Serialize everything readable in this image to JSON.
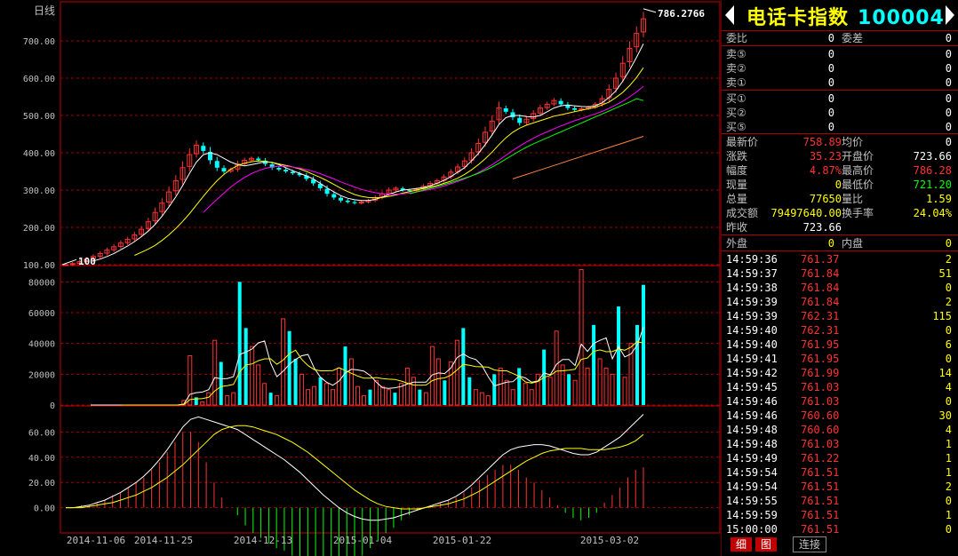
{
  "chart_data": {
    "type": "candlestick",
    "title": "日线",
    "last_label": "786.2766",
    "start_label": "100",
    "price_axis": {
      "ticks": [
        "700.00",
        "600.00",
        "500.00",
        "400.00",
        "300.00",
        "200.00",
        "100.00"
      ],
      "ylim": [
        100,
        800
      ]
    },
    "volume_axis": {
      "ticks": [
        "80000",
        "60000",
        "40000",
        "20000",
        "0"
      ],
      "ylim": [
        0,
        90000
      ]
    },
    "macd_axis": {
      "ticks": [
        "60.00",
        "40.00",
        "20.00",
        "0.00"
      ],
      "ylim": [
        -20,
        80
      ]
    },
    "date_labels": [
      "2014-11-06",
      "2014-11-25",
      "2014-12-13",
      "2015-01-04",
      "2015-01-22",
      "2015-03-02"
    ],
    "closes": [
      100,
      103,
      108,
      115,
      122,
      130,
      139,
      148,
      158,
      168,
      180,
      195,
      215,
      240,
      265,
      295,
      325,
      360,
      395,
      420,
      405,
      380,
      360,
      350,
      355,
      370,
      380,
      385,
      380,
      370,
      360,
      355,
      350,
      345,
      340,
      330,
      318,
      305,
      290,
      280,
      272,
      268,
      265,
      268,
      272,
      280,
      290,
      300,
      305,
      300,
      298,
      302,
      310,
      318,
      325,
      335,
      348,
      362,
      378,
      400,
      425,
      455,
      485,
      520,
      510,
      495,
      480,
      490,
      505,
      520,
      530,
      540,
      530,
      520,
      515,
      518,
      522,
      530,
      545,
      570,
      600,
      640,
      680,
      720,
      759
    ],
    "volumes": [
      0,
      0,
      0,
      0,
      0,
      0,
      0,
      0,
      0,
      0,
      0,
      0,
      0,
      0,
      0,
      0,
      0,
      0,
      0,
      3000,
      32000,
      5000,
      2000,
      8000,
      42000,
      28000,
      6000,
      8000,
      80000,
      50000,
      38000,
      26000,
      14000,
      8000,
      6000,
      56000,
      48000,
      30000,
      20000,
      10000,
      12000,
      18000,
      14000,
      10000,
      24000,
      38000,
      30000,
      12000,
      6000,
      10000,
      16000,
      12000,
      10000,
      8000,
      14000,
      24000,
      18000,
      10000,
      8000,
      38000,
      30000,
      16000,
      28000,
      42000,
      50000,
      18000,
      10000,
      8000,
      6000,
      20000,
      24000,
      16000,
      10000,
      24000,
      14000,
      10000,
      20000,
      36000,
      18000,
      48000,
      26000,
      20000,
      16000,
      88000,
      24000,
      52000,
      30000,
      24000,
      20000,
      64000,
      18000,
      40000,
      52000,
      78000
    ],
    "dif": [
      0,
      0,
      1,
      2,
      4,
      6,
      9,
      12,
      16,
      20,
      25,
      31,
      38,
      46,
      55,
      64,
      70,
      72,
      70,
      68,
      66,
      64,
      62,
      58,
      54,
      50,
      46,
      42,
      38,
      33,
      28,
      22,
      16,
      10,
      5,
      0,
      -4,
      -7,
      -9,
      -10,
      -10,
      -9,
      -8,
      -6,
      -4,
      -2,
      0,
      2,
      4,
      6,
      9,
      13,
      18,
      24,
      30,
      36,
      42,
      46,
      48,
      49,
      50,
      50,
      49,
      47,
      45,
      43,
      42,
      42,
      44,
      48,
      52,
      56,
      62,
      68,
      74
    ],
    "dea": [
      0,
      0,
      0,
      1,
      2,
      3,
      4,
      6,
      8,
      10,
      13,
      16,
      20,
      24,
      29,
      34,
      40,
      46,
      52,
      58,
      62,
      64,
      65,
      65,
      64,
      62,
      60,
      58,
      55,
      52,
      48,
      44,
      39,
      34,
      29,
      24,
      19,
      14,
      10,
      6,
      3,
      1,
      0,
      -1,
      -1,
      -1,
      0,
      1,
      2,
      3,
      5,
      7,
      10,
      13,
      17,
      21,
      25,
      29,
      33,
      37,
      40,
      43,
      45,
      46,
      47,
      47,
      47,
      46,
      46,
      46,
      47,
      48,
      50,
      53,
      58
    ],
    "ma": {
      "ma1": {
        "color": "#ffffff",
        "values": [
          null,
          null,
          null,
          null,
          110,
          115,
          122,
          130,
          140,
          150,
          162,
          175,
          190,
          208,
          230,
          255,
          282,
          312,
          345,
          375,
          395,
          400,
          395,
          385,
          375,
          368,
          365,
          368,
          372,
          376,
          374,
          368,
          360,
          352,
          345,
          338,
          330,
          318,
          306,
          295,
          285,
          278,
          274,
          272,
          272,
          275,
          281,
          288,
          295,
          300,
          302,
          304,
          307,
          312,
          318,
          326,
          336,
          348,
          360,
          378,
          398,
          422,
          448,
          476,
          494,
          500,
          500,
          497,
          496,
          500,
          510,
          520,
          526,
          528,
          526,
          524,
          523,
          526,
          534,
          548,
          566,
          592,
          622,
          656,
          692
        ]
      },
      "ma2": {
        "color": "#ffff00",
        "values": [
          null,
          null,
          null,
          null,
          null,
          null,
          null,
          null,
          null,
          null,
          125,
          133,
          142,
          152,
          165,
          180,
          197,
          216,
          237,
          260,
          283,
          305,
          325,
          342,
          356,
          366,
          372,
          376,
          378,
          377,
          374,
          370,
          366,
          362,
          357,
          350,
          342,
          334,
          325,
          315,
          305,
          296,
          288,
          283,
          280,
          279,
          280,
          283,
          287,
          292,
          296,
          300,
          304,
          308,
          312,
          318,
          324,
          332,
          342,
          354,
          368,
          384,
          402,
          422,
          440,
          455,
          466,
          474,
          480,
          486,
          492,
          498,
          502,
          506,
          510,
          514,
          518,
          522,
          528,
          536,
          548,
          562,
          580,
          602,
          628
        ]
      },
      "ma3": {
        "color": "#ff00ff",
        "values": [
          null,
          null,
          null,
          null,
          null,
          null,
          null,
          null,
          null,
          null,
          null,
          null,
          null,
          null,
          null,
          null,
          null,
          null,
          null,
          null,
          240,
          258,
          275,
          292,
          308,
          322,
          334,
          344,
          352,
          358,
          362,
          364,
          364,
          362,
          359,
          355,
          350,
          344,
          337,
          330,
          322,
          315,
          308,
          302,
          297,
          293,
          290,
          289,
          289,
          290,
          292,
          295,
          298,
          302,
          306,
          311,
          317,
          323,
          330,
          338,
          347,
          357,
          368,
          380,
          393,
          406,
          418,
          429,
          439,
          448,
          456,
          464,
          472,
          479,
          486,
          492,
          498,
          504,
          511,
          519,
          528,
          538,
          550,
          563,
          578
        ]
      },
      "ma4": {
        "color": "#00ff00",
        "values": [
          null,
          null,
          null,
          null,
          null,
          null,
          null,
          null,
          null,
          null,
          null,
          null,
          null,
          null,
          null,
          null,
          null,
          null,
          null,
          null,
          null,
          null,
          null,
          null,
          null,
          null,
          null,
          null,
          null,
          null,
          null,
          null,
          null,
          null,
          null,
          null,
          null,
          null,
          null,
          null,
          null,
          null,
          null,
          null,
          null,
          null,
          null,
          null,
          null,
          null,
          290,
          295,
          300,
          305,
          310,
          315,
          320,
          326,
          332,
          338,
          345,
          353,
          362,
          372,
          383,
          394,
          405,
          415,
          424,
          432,
          440,
          448,
          456,
          464,
          472,
          480,
          488,
          496,
          504,
          512,
          520,
          528,
          536,
          545,
          540
        ]
      },
      "ma5": {
        "color": "#ff8040",
        "values": [
          null,
          null,
          null,
          null,
          null,
          null,
          null,
          null,
          null,
          null,
          null,
          null,
          null,
          null,
          null,
          null,
          null,
          null,
          null,
          null,
          null,
          null,
          null,
          null,
          null,
          null,
          null,
          null,
          null,
          null,
          null,
          null,
          null,
          null,
          null,
          null,
          null,
          null,
          null,
          null,
          null,
          null,
          null,
          null,
          null,
          null,
          null,
          null,
          null,
          null,
          null,
          null,
          null,
          null,
          null,
          null,
          null,
          null,
          null,
          null,
          null,
          null,
          null,
          null,
          null,
          330,
          336,
          342,
          348,
          354,
          360,
          366,
          372,
          378,
          384,
          390,
          396,
          402,
          408,
          414,
          420,
          426,
          432,
          438,
          444
        ]
      }
    }
  },
  "panel": {
    "title": "电话卡指数",
    "code": "100004",
    "order_rows": [
      {
        "l1": "委比",
        "v1": "0",
        "l2": "委差",
        "v2": "0"
      }
    ],
    "sell_rows": [
      {
        "label": "卖⑤",
        "price": "0",
        "vol": "0"
      },
      {
        "label": "卖②",
        "price": "0",
        "vol": "0"
      },
      {
        "label": "卖①",
        "price": "0",
        "vol": "0"
      }
    ],
    "buy_rows": [
      {
        "label": "买①",
        "price": "0",
        "vol": "0"
      },
      {
        "label": "买②",
        "price": "0",
        "vol": "0"
      },
      {
        "label": "买⑤",
        "price": "0",
        "vol": "0"
      }
    ],
    "quote_rows": [
      {
        "l1": "最新价",
        "v1": "758.89",
        "c1": "r",
        "l2": "均价",
        "v2": "0",
        "c2": "w"
      },
      {
        "l1": "涨跌",
        "v1": "35.23",
        "c1": "r",
        "l2": "开盘价",
        "v2": "723.66",
        "c2": "w"
      },
      {
        "l1": "幅度",
        "v1": "4.87%",
        "c1": "r",
        "l2": "最高价",
        "v2": "786.28",
        "c2": "r"
      },
      {
        "l1": "现量",
        "v1": "0",
        "c1": "y",
        "l2": "最低价",
        "v2": "721.20",
        "c2": "g"
      },
      {
        "l1": "总量",
        "v1": "77650",
        "c1": "y",
        "l2": "量比",
        "v2": "1.59",
        "c2": "y"
      },
      {
        "l1": "成交额",
        "v1": "79497640.00",
        "c1": "y",
        "l2": "换手率",
        "v2": "24.04%",
        "c2": "y"
      },
      {
        "l1": "昨收",
        "v1": "723.66",
        "c1": "w",
        "l2": "",
        "v2": "",
        "c2": "w"
      }
    ],
    "outer_inner": {
      "l1": "外盘",
      "v1": "0",
      "l2": "内盘",
      "v2": "0"
    },
    "ticks": [
      {
        "time": "14:59:36",
        "price": "761.37",
        "vol": "2"
      },
      {
        "time": "14:59:37",
        "price": "761.84",
        "vol": "51"
      },
      {
        "time": "14:59:38",
        "price": "761.84",
        "vol": "0"
      },
      {
        "time": "14:59:39",
        "price": "761.84",
        "vol": "2"
      },
      {
        "time": "14:59:39",
        "price": "762.31",
        "vol": "115"
      },
      {
        "time": "14:59:40",
        "price": "762.31",
        "vol": "0"
      },
      {
        "time": "14:59:40",
        "price": "761.95",
        "vol": "6"
      },
      {
        "time": "14:59:41",
        "price": "761.95",
        "vol": "0"
      },
      {
        "time": "14:59:42",
        "price": "761.99",
        "vol": "14"
      },
      {
        "time": "14:59:45",
        "price": "761.03",
        "vol": "4"
      },
      {
        "time": "14:59:46",
        "price": "761.03",
        "vol": "0"
      },
      {
        "time": "14:59:46",
        "price": "760.60",
        "vol": "30"
      },
      {
        "time": "14:59:48",
        "price": "760.60",
        "vol": "4"
      },
      {
        "time": "14:59:48",
        "price": "761.03",
        "vol": "1"
      },
      {
        "time": "14:59:49",
        "price": "761.22",
        "vol": "1"
      },
      {
        "time": "14:59:54",
        "price": "761.51",
        "vol": "1"
      },
      {
        "time": "14:59:54",
        "price": "761.51",
        "vol": "2"
      },
      {
        "time": "14:59:55",
        "price": "761.51",
        "vol": "0"
      },
      {
        "time": "14:59:59",
        "price": "761.51",
        "vol": "1"
      },
      {
        "time": "15:00:00",
        "price": "761.51",
        "vol": "0"
      }
    ],
    "tabs": [
      "细",
      "图",
      "连接"
    ]
  }
}
